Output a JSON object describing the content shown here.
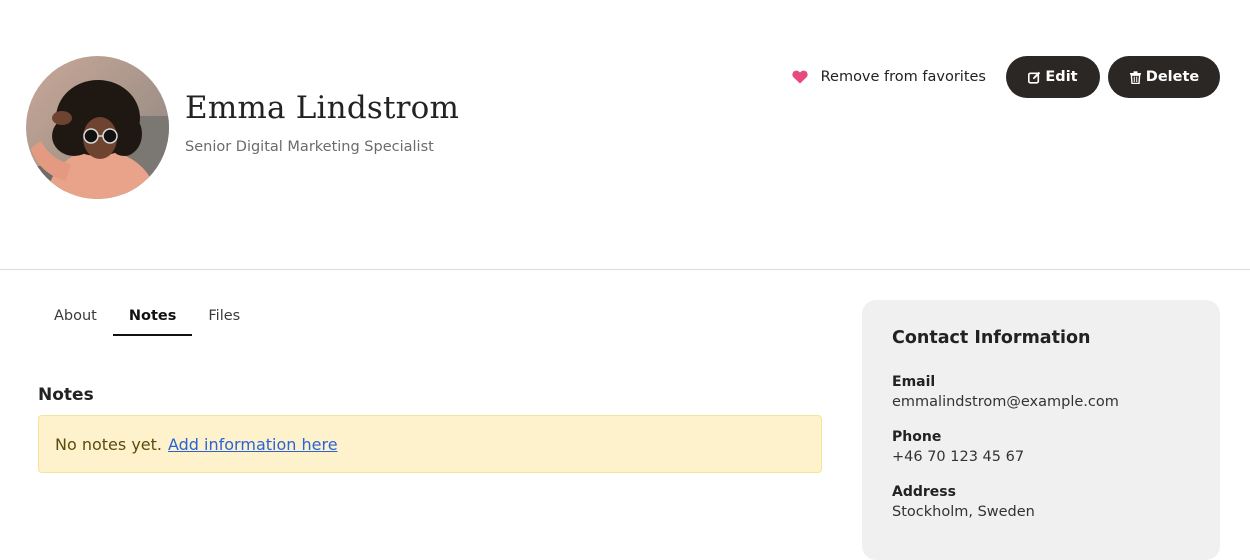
{
  "profile": {
    "name": "Emma Lindstrom",
    "job_title": "Senior Digital Marketing Specialist",
    "avatar_icon": "person-avatar-photo"
  },
  "actions": {
    "favorite_label": "Remove from favorites",
    "favorite_icon": "heart-icon",
    "favorite_color": "#e84a7f",
    "edit_label": "Edit",
    "edit_icon": "edit-icon",
    "delete_label": "Delete",
    "delete_icon": "trash-icon",
    "button_color": "#2b2724"
  },
  "tabs": [
    {
      "label": "About",
      "active": false
    },
    {
      "label": "Notes",
      "active": true
    },
    {
      "label": "Files",
      "active": false
    }
  ],
  "notes": {
    "heading": "Notes",
    "empty_text": "No notes yet.",
    "link_text": "Add information here",
    "alert_color": "#fdf2cc"
  },
  "contact": {
    "heading": "Contact Information",
    "fields": [
      {
        "label": "Email",
        "value": "emmalindstrom@example.com"
      },
      {
        "label": "Phone",
        "value": "+46 70 123 45 67"
      },
      {
        "label": "Address",
        "value": "Stockholm, Sweden"
      }
    ]
  }
}
